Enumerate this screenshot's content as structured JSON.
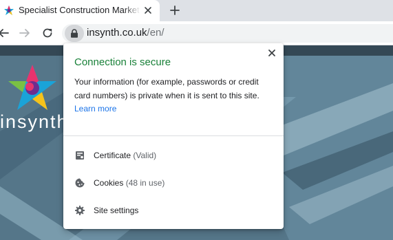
{
  "browser": {
    "tab": {
      "title": "Specialist Construction Marketing"
    },
    "address": {
      "host": "insynth.co.uk",
      "path": "/en/"
    }
  },
  "site": {
    "wordmark": "insynth"
  },
  "popup": {
    "title": "Connection is secure",
    "body": "Your information (for example, passwords or credit card numbers) is private when it is sent to this site.",
    "learn_more": "Learn more",
    "items": [
      {
        "label": "Certificate",
        "detail": "(Valid)",
        "icon": "certificate-icon"
      },
      {
        "label": "Cookies",
        "detail": "(48 in use)",
        "icon": "cookie-icon"
      },
      {
        "label": "Site settings",
        "detail": "",
        "icon": "gear-icon"
      }
    ]
  },
  "colors": {
    "secure_green": "#188038",
    "link_blue": "#1a73e8",
    "tabstrip": "#dee1e6"
  }
}
